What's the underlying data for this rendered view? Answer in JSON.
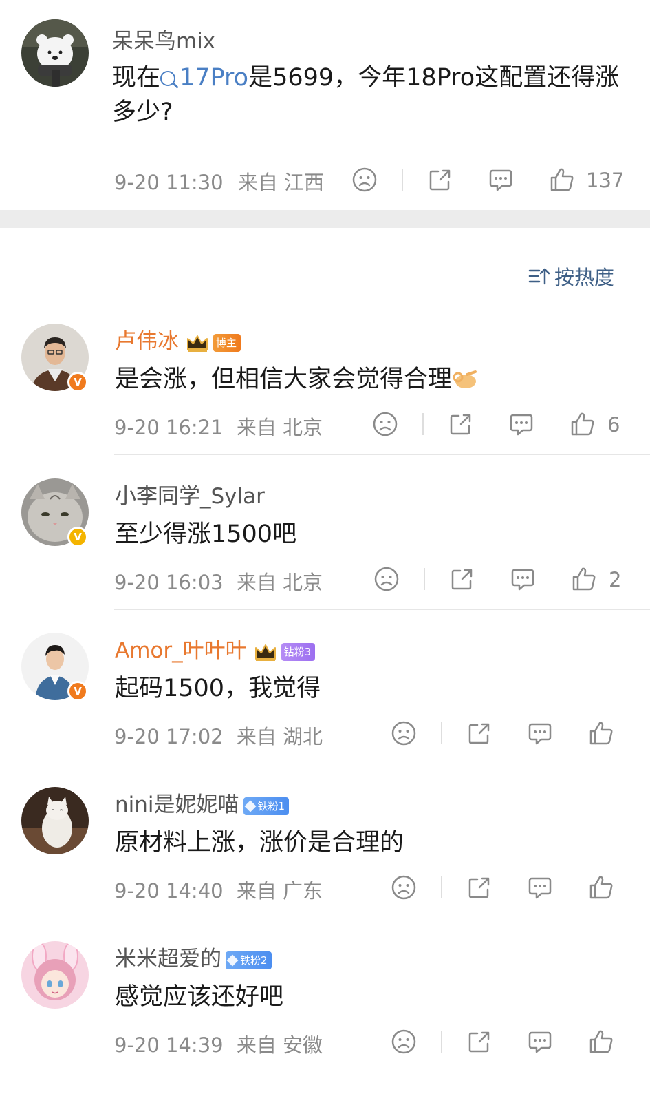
{
  "post": {
    "username": "呆呆鸟mix",
    "body_before": "现在",
    "body_link": "17Pro",
    "body_after": "是5699，今年18Pro这配置还得涨多少?",
    "time": "9-20 11:30",
    "location": "来自 江西",
    "likes": "137"
  },
  "sort": {
    "label": "按热度"
  },
  "comments": [
    {
      "username": "卢伟冰",
      "badge": "博主",
      "text": "是会涨，但相信大家会觉得合理",
      "time": "9-20 16:21",
      "location": "来自 北京",
      "likes": "6"
    },
    {
      "username": "小李同学_Sylar",
      "badge": "",
      "text": "至少得涨1500吧",
      "time": "9-20 16:03",
      "location": "来自 北京",
      "likes": "2"
    },
    {
      "username": "Amor_叶叶叶",
      "badge": "钻粉3",
      "text": "起码1500，我觉得",
      "time": "9-20 17:02",
      "location": "来自 湖北",
      "likes": ""
    },
    {
      "username": "nini是妮妮喵",
      "badge": "铁粉1",
      "text": "原材料上涨，涨价是合理的",
      "time": "9-20 14:40",
      "location": "来自 广东",
      "likes": ""
    },
    {
      "username": "米米超爱的",
      "badge": "铁粉2",
      "text": "感觉应该还好吧",
      "time": "9-20 14:39",
      "location": "来自 安徽",
      "likes": ""
    }
  ],
  "icons": {
    "dislike": "frown-icon",
    "share": "share-icon",
    "reply": "comment-icon",
    "like": "thumbs-up-icon",
    "sort": "sort-icon"
  },
  "colors": {
    "link": "#4a7fc4",
    "vip_name": "#e8782f",
    "meta": "#8a8a8a",
    "sort": "#3e5f86"
  }
}
